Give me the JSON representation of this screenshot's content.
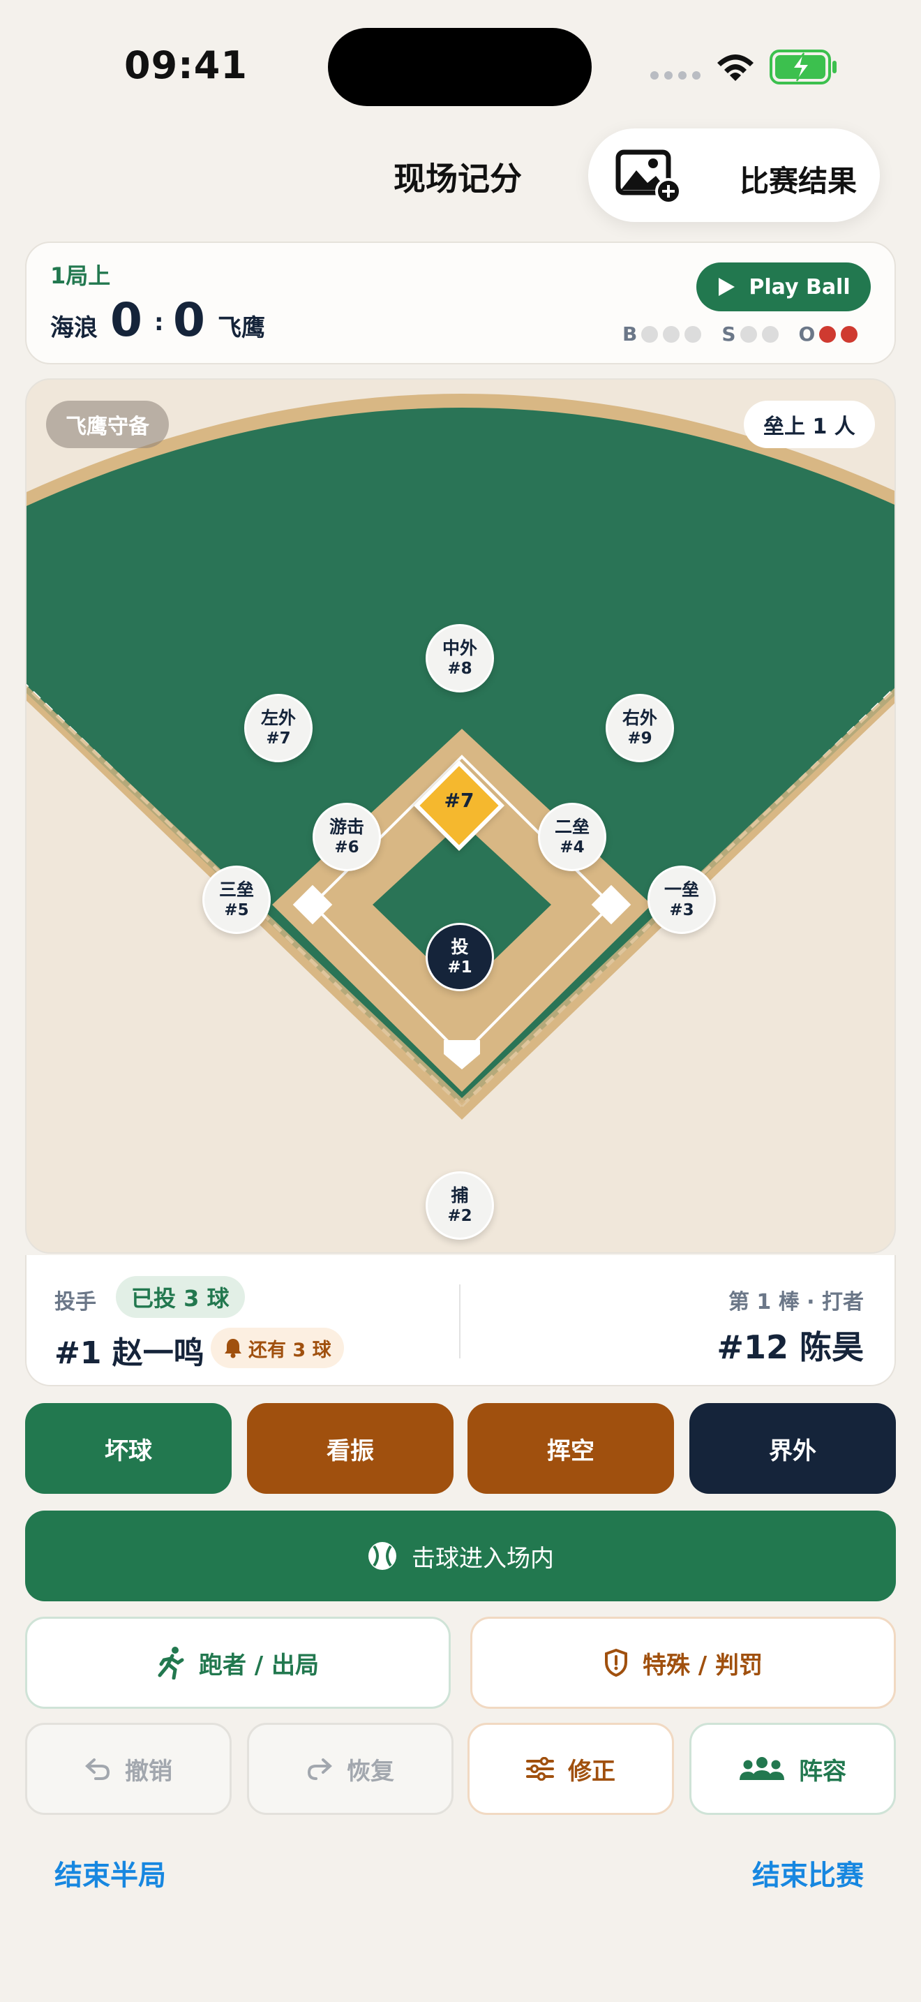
{
  "status": {
    "time": "09:41"
  },
  "nav": {
    "title": "现场记分",
    "result_label": "比赛结果"
  },
  "score": {
    "inning": "1局上",
    "home_team": "海浪",
    "home_score": "0",
    "separator": ":",
    "away_score": "0",
    "away_team": "飞鹰",
    "play_ball_label": "Play Ball",
    "count": {
      "balls_label": "B",
      "strikes_label": "S",
      "outs_label": "O",
      "balls": 0,
      "strikes": 0,
      "outs": 2
    }
  },
  "field": {
    "defense_chip": "飞鹰守备",
    "runners_chip": "垒上 1 人",
    "runner_on_second": "#7",
    "positions": [
      {
        "name": "中外",
        "num": "#8"
      },
      {
        "name": "左外",
        "num": "#7"
      },
      {
        "name": "右外",
        "num": "#9"
      },
      {
        "name": "游击",
        "num": "#6"
      },
      {
        "name": "二垒",
        "num": "#4"
      },
      {
        "name": "三垒",
        "num": "#5"
      },
      {
        "name": "一垒",
        "num": "#3"
      },
      {
        "name": "投",
        "num": "#1"
      },
      {
        "name": "捕",
        "num": "#2"
      }
    ],
    "colors": {
      "outfield": "#2a7456",
      "dirt": "#d8b784",
      "warning": "#e9dcc6",
      "foul": "#f0e7da"
    }
  },
  "info": {
    "pitcher_label": "投手",
    "pitch_count": "已投 3 球",
    "pitcher_name": "#1 赵一鸣",
    "remaining": "还有 3 球",
    "batter_label": "第 1 棒 · 打者",
    "batter_name": "#12 陈昊"
  },
  "actions": {
    "ball": "坏球",
    "called_strike": "看振",
    "swinging_strike": "挥空",
    "foul": "界外",
    "in_play": "击球进入场内",
    "runner_out": "跑者 / 出局",
    "special": "特殊 / 判罚",
    "undo": "撤销",
    "redo": "恢复",
    "correct": "修正",
    "lineup": "阵容",
    "end_half": "结束半局",
    "end_game": "结束比赛"
  }
}
